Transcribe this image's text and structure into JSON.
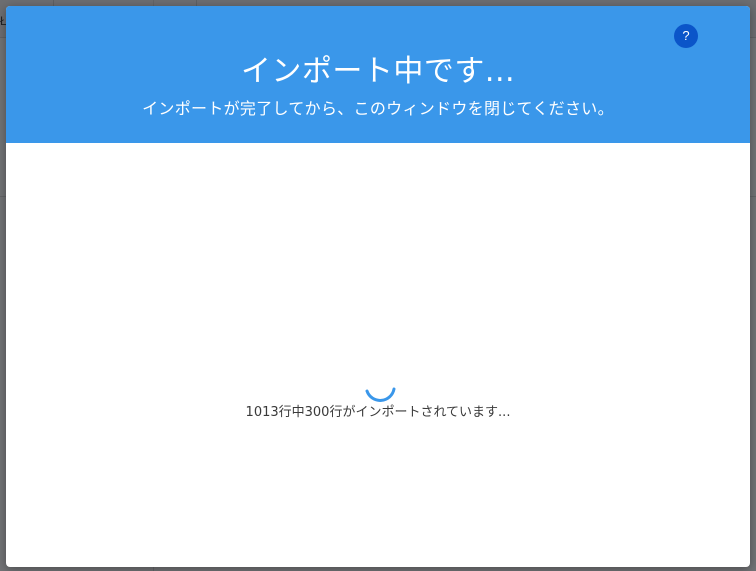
{
  "background": {
    "corner_text": "Ł"
  },
  "modal": {
    "title": "インポート中です...",
    "subtitle": "インポートが完了してから、このウィンドウを閉じてください。",
    "help_label": "?",
    "progress_text": "1013行中300行がインポートされています...",
    "header_color": "#3a97ea",
    "help_color": "#0b55c9",
    "spinner_color": "#3a97ea"
  }
}
